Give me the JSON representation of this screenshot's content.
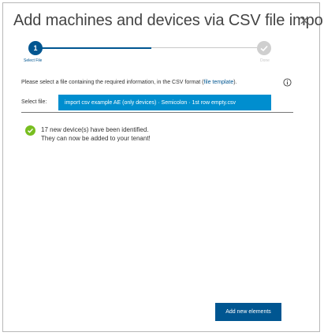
{
  "dialog": {
    "title": "Add machines and devices via CSV file import",
    "close_icon": "close-icon"
  },
  "stepper": {
    "steps": [
      {
        "number": "1",
        "label": "Select File",
        "state": "active"
      },
      {
        "number": "",
        "label": "Done",
        "state": "pending"
      }
    ],
    "active_color": "#005691",
    "inactive_color": "#cfcfcf"
  },
  "instruction": {
    "text_before": "Please select a file containing the required information, in the CSV format (",
    "link_text": "file template",
    "text_after": ").",
    "info_icon": "info-icon"
  },
  "file_select": {
    "label": "Select file:",
    "value": "import csv example AE (only devices) · Semicolon · 1st row empty.csv",
    "background": "#008ecf"
  },
  "result": {
    "icon": "check-circle-icon",
    "line1": "17 new device(s) have been identified.",
    "line2": "They can now be added to your tenant!",
    "color": "#78be20"
  },
  "actions": {
    "add_label": "Add new elements",
    "color": "#005691"
  }
}
